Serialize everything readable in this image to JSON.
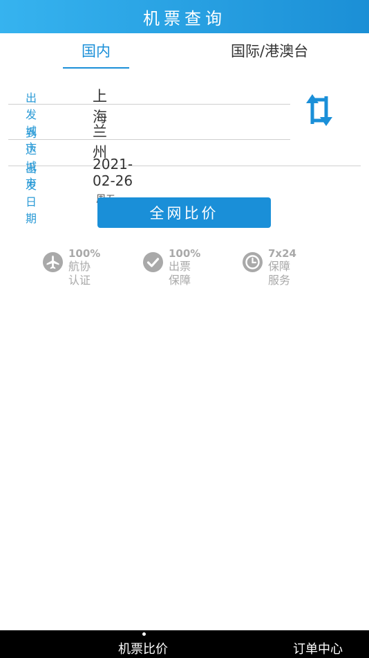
{
  "header": {
    "title": "机票查询"
  },
  "tabs": [
    {
      "label": "国内",
      "active": true
    },
    {
      "label": "国际/港澳台",
      "active": false
    }
  ],
  "form": {
    "from": {
      "label": "出发城市",
      "value": "上海"
    },
    "to": {
      "label": "到达城市",
      "value": "兰州"
    },
    "date": {
      "label": "出发日期",
      "value": "2021-02-26",
      "weekday": "周五"
    },
    "swap_icon": "swap-icon"
  },
  "search_button": {
    "label": "全网比价"
  },
  "features": [
    {
      "icon": "airplane-icon",
      "top": "100%",
      "bottom": "航协认证"
    },
    {
      "icon": "check-circle-icon",
      "top": "100%",
      "bottom": "出票保障"
    },
    {
      "icon": "clock-icon",
      "top": "7x24",
      "bottom": "保障服务"
    }
  ],
  "bottom_nav": [
    {
      "label": "机票比价",
      "active": true
    },
    {
      "label": "订单中心",
      "active": false
    }
  ],
  "colors": {
    "accent": "#1a8fd8",
    "header_start": "#36b3ef",
    "header_end": "#1b8fd6",
    "label": "#2a9ad6",
    "feature_gray": "#a9a9a9",
    "bottom_bar": "#000000"
  }
}
